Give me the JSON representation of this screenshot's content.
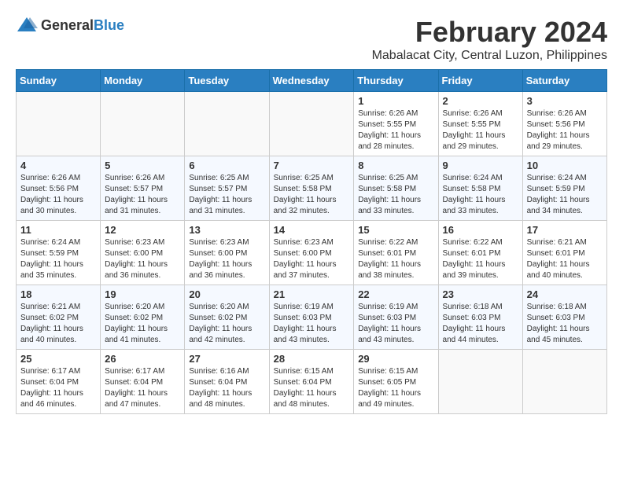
{
  "header": {
    "logo_general": "General",
    "logo_blue": "Blue",
    "month_title": "February 2024",
    "location": "Mabalacat City, Central Luzon, Philippines"
  },
  "weekdays": [
    "Sunday",
    "Monday",
    "Tuesday",
    "Wednesday",
    "Thursday",
    "Friday",
    "Saturday"
  ],
  "weeks": [
    [
      {
        "day": "",
        "info": ""
      },
      {
        "day": "",
        "info": ""
      },
      {
        "day": "",
        "info": ""
      },
      {
        "day": "",
        "info": ""
      },
      {
        "day": "1",
        "info": "Sunrise: 6:26 AM\nSunset: 5:55 PM\nDaylight: 11 hours and 28 minutes."
      },
      {
        "day": "2",
        "info": "Sunrise: 6:26 AM\nSunset: 5:55 PM\nDaylight: 11 hours and 29 minutes."
      },
      {
        "day": "3",
        "info": "Sunrise: 6:26 AM\nSunset: 5:56 PM\nDaylight: 11 hours and 29 minutes."
      }
    ],
    [
      {
        "day": "4",
        "info": "Sunrise: 6:26 AM\nSunset: 5:56 PM\nDaylight: 11 hours and 30 minutes."
      },
      {
        "day": "5",
        "info": "Sunrise: 6:26 AM\nSunset: 5:57 PM\nDaylight: 11 hours and 31 minutes."
      },
      {
        "day": "6",
        "info": "Sunrise: 6:25 AM\nSunset: 5:57 PM\nDaylight: 11 hours and 31 minutes."
      },
      {
        "day": "7",
        "info": "Sunrise: 6:25 AM\nSunset: 5:58 PM\nDaylight: 11 hours and 32 minutes."
      },
      {
        "day": "8",
        "info": "Sunrise: 6:25 AM\nSunset: 5:58 PM\nDaylight: 11 hours and 33 minutes."
      },
      {
        "day": "9",
        "info": "Sunrise: 6:24 AM\nSunset: 5:58 PM\nDaylight: 11 hours and 33 minutes."
      },
      {
        "day": "10",
        "info": "Sunrise: 6:24 AM\nSunset: 5:59 PM\nDaylight: 11 hours and 34 minutes."
      }
    ],
    [
      {
        "day": "11",
        "info": "Sunrise: 6:24 AM\nSunset: 5:59 PM\nDaylight: 11 hours and 35 minutes."
      },
      {
        "day": "12",
        "info": "Sunrise: 6:23 AM\nSunset: 6:00 PM\nDaylight: 11 hours and 36 minutes."
      },
      {
        "day": "13",
        "info": "Sunrise: 6:23 AM\nSunset: 6:00 PM\nDaylight: 11 hours and 36 minutes."
      },
      {
        "day": "14",
        "info": "Sunrise: 6:23 AM\nSunset: 6:00 PM\nDaylight: 11 hours and 37 minutes."
      },
      {
        "day": "15",
        "info": "Sunrise: 6:22 AM\nSunset: 6:01 PM\nDaylight: 11 hours and 38 minutes."
      },
      {
        "day": "16",
        "info": "Sunrise: 6:22 AM\nSunset: 6:01 PM\nDaylight: 11 hours and 39 minutes."
      },
      {
        "day": "17",
        "info": "Sunrise: 6:21 AM\nSunset: 6:01 PM\nDaylight: 11 hours and 40 minutes."
      }
    ],
    [
      {
        "day": "18",
        "info": "Sunrise: 6:21 AM\nSunset: 6:02 PM\nDaylight: 11 hours and 40 minutes."
      },
      {
        "day": "19",
        "info": "Sunrise: 6:20 AM\nSunset: 6:02 PM\nDaylight: 11 hours and 41 minutes."
      },
      {
        "day": "20",
        "info": "Sunrise: 6:20 AM\nSunset: 6:02 PM\nDaylight: 11 hours and 42 minutes."
      },
      {
        "day": "21",
        "info": "Sunrise: 6:19 AM\nSunset: 6:03 PM\nDaylight: 11 hours and 43 minutes."
      },
      {
        "day": "22",
        "info": "Sunrise: 6:19 AM\nSunset: 6:03 PM\nDaylight: 11 hours and 43 minutes."
      },
      {
        "day": "23",
        "info": "Sunrise: 6:18 AM\nSunset: 6:03 PM\nDaylight: 11 hours and 44 minutes."
      },
      {
        "day": "24",
        "info": "Sunrise: 6:18 AM\nSunset: 6:03 PM\nDaylight: 11 hours and 45 minutes."
      }
    ],
    [
      {
        "day": "25",
        "info": "Sunrise: 6:17 AM\nSunset: 6:04 PM\nDaylight: 11 hours and 46 minutes."
      },
      {
        "day": "26",
        "info": "Sunrise: 6:17 AM\nSunset: 6:04 PM\nDaylight: 11 hours and 47 minutes."
      },
      {
        "day": "27",
        "info": "Sunrise: 6:16 AM\nSunset: 6:04 PM\nDaylight: 11 hours and 48 minutes."
      },
      {
        "day": "28",
        "info": "Sunrise: 6:15 AM\nSunset: 6:04 PM\nDaylight: 11 hours and 48 minutes."
      },
      {
        "day": "29",
        "info": "Sunrise: 6:15 AM\nSunset: 6:05 PM\nDaylight: 11 hours and 49 minutes."
      },
      {
        "day": "",
        "info": ""
      },
      {
        "day": "",
        "info": ""
      }
    ]
  ]
}
